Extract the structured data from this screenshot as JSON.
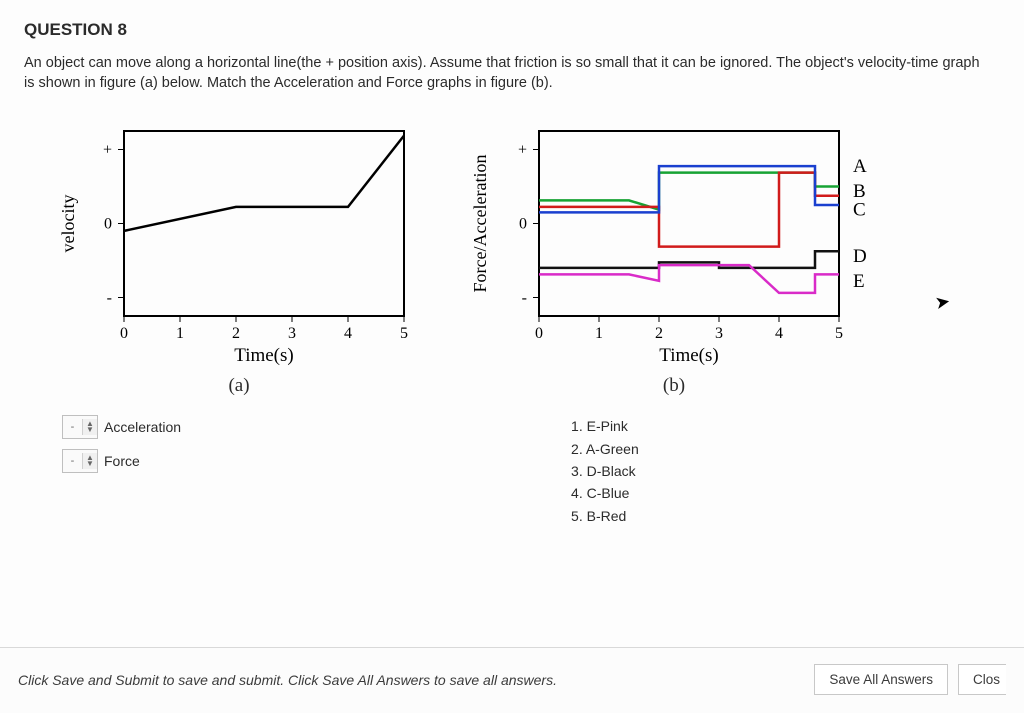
{
  "question": {
    "title": "QUESTION 8",
    "prompt": "An object can move along a horizontal line(the + position axis). Assume that friction is so small that it can be ignored. The object's velocity-time graph is shown in figure (a) below. Match the Acceleration and Force graphs in figure (b)."
  },
  "chart_data": [
    {
      "id": "a",
      "type": "line",
      "title": "",
      "xlabel": "Time(s)",
      "ylabel": "velocity",
      "x": [
        0,
        2,
        4,
        5
      ],
      "y": [
        -0.08,
        0.18,
        0.18,
        0.95
      ],
      "yticks": [
        "+",
        "0",
        "-"
      ],
      "xticks": [
        0,
        1,
        2,
        3,
        4,
        5
      ],
      "xlim": [
        0,
        5
      ],
      "ylim": [
        -1,
        1
      ],
      "figlabel": "(a)"
    },
    {
      "id": "b",
      "type": "line",
      "title": "",
      "xlabel": "Time(s)",
      "ylabel": "Force/Acceleration",
      "yticks": [
        "+",
        "0",
        "-"
      ],
      "xticks": [
        0,
        1,
        2,
        3,
        4,
        5
      ],
      "xlim": [
        0,
        5
      ],
      "ylim": [
        -1,
        1
      ],
      "figlabel": "(b)",
      "right_labels": [
        "A",
        "B",
        "C",
        "D",
        "E"
      ],
      "series": [
        {
          "name": "A",
          "color": "#17a334",
          "points": [
            [
              0,
              0.25
            ],
            [
              1.5,
              0.25
            ],
            [
              2,
              0.15
            ],
            [
              2,
              0.55
            ],
            [
              4.6,
              0.55
            ],
            [
              4.6,
              0.4
            ],
            [
              5,
              0.4
            ]
          ]
        },
        {
          "name": "B",
          "color": "#d11b1b",
          "points": [
            [
              0,
              0.18
            ],
            [
              2,
              0.18
            ],
            [
              2,
              -0.25
            ],
            [
              4,
              -0.25
            ],
            [
              4,
              0.55
            ],
            [
              4.6,
              0.55
            ],
            [
              4.6,
              0.3
            ],
            [
              5,
              0.3
            ]
          ]
        },
        {
          "name": "C",
          "color": "#1a3fcf",
          "points": [
            [
              0,
              0.12
            ],
            [
              2,
              0.12
            ],
            [
              2,
              0.62
            ],
            [
              4.6,
              0.62
            ],
            [
              4.6,
              0.2
            ],
            [
              5,
              0.2
            ]
          ]
        },
        {
          "name": "D",
          "color": "#111",
          "points": [
            [
              0,
              -0.48
            ],
            [
              2,
              -0.48
            ],
            [
              2,
              -0.42
            ],
            [
              3,
              -0.42
            ],
            [
              3,
              -0.48
            ],
            [
              4.6,
              -0.48
            ],
            [
              4.6,
              -0.3
            ],
            [
              5,
              -0.3
            ]
          ]
        },
        {
          "name": "E",
          "color": "#d92bc8",
          "points": [
            [
              0,
              -0.55
            ],
            [
              1.5,
              -0.55
            ],
            [
              2,
              -0.62
            ],
            [
              2,
              -0.45
            ],
            [
              3.5,
              -0.45
            ],
            [
              4,
              -0.75
            ],
            [
              4.6,
              -0.75
            ],
            [
              4.6,
              -0.55
            ],
            [
              5,
              -0.55
            ]
          ]
        }
      ]
    }
  ],
  "matchers": [
    {
      "label": "Acceleration",
      "value": "-"
    },
    {
      "label": "Force",
      "value": "-"
    }
  ],
  "key": [
    "1. E-Pink",
    "2. A-Green",
    "3. D-Black",
    "4. C-Blue",
    "5. B-Red"
  ],
  "footer": {
    "hint": "Click Save and Submit to save and submit. Click Save All Answers to save all answers.",
    "save_all": "Save All Answers",
    "close": "Clos"
  }
}
